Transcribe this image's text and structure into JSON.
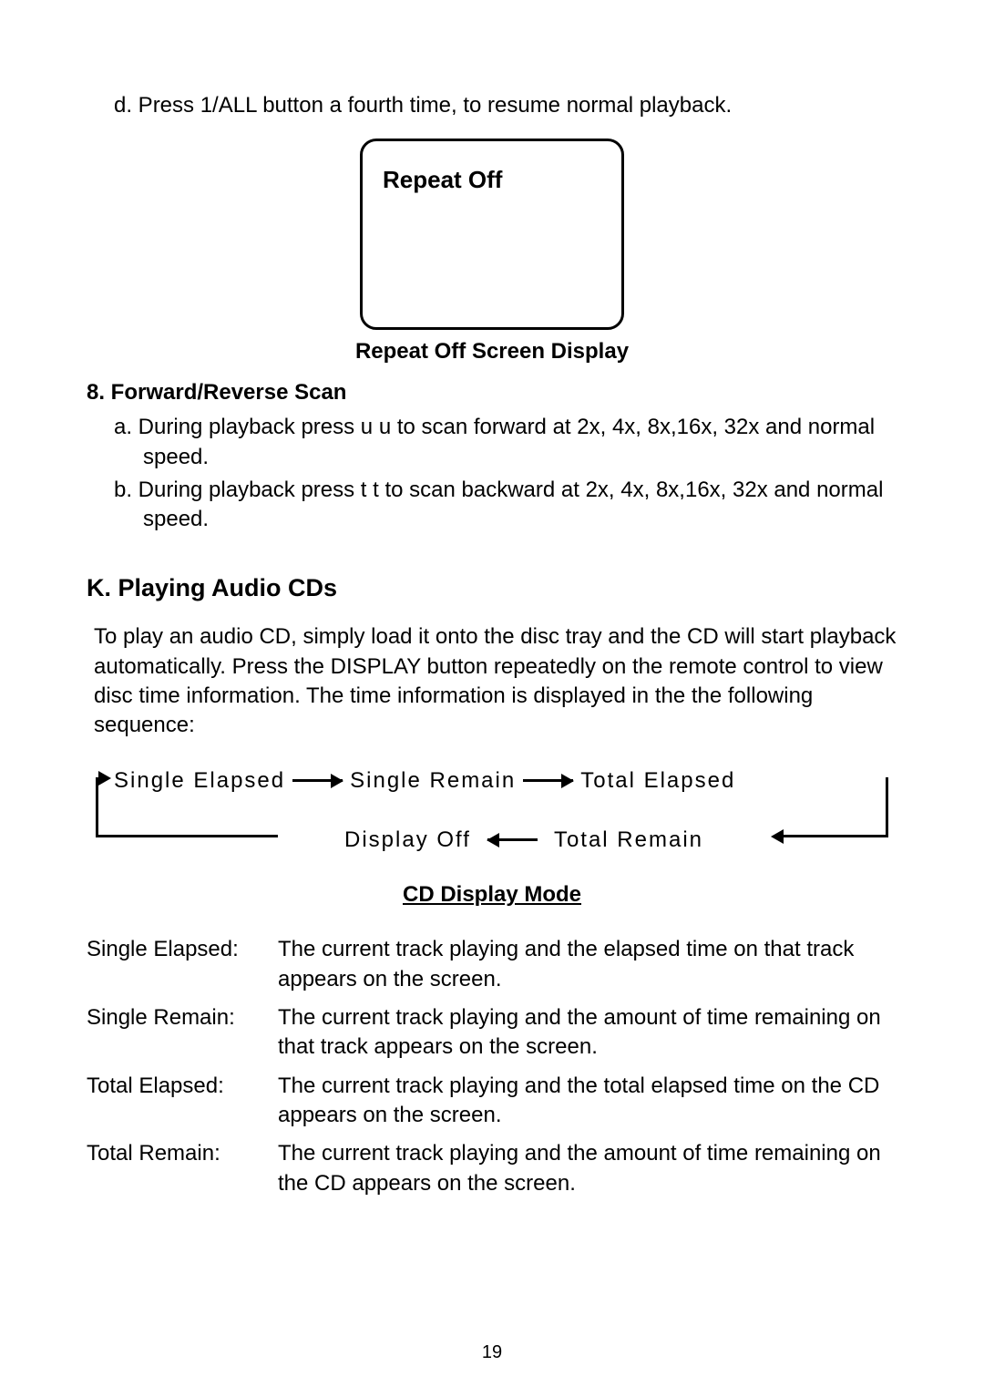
{
  "step_d": "d.  Press 1/ALL button a fourth time, to resume normal playback.",
  "screen_box": "Repeat  Off",
  "repeat_caption": "Repeat Off Screen Display",
  "section8_title": "8. Forward/Reverse Scan",
  "section8_a": "a. During playback press u u   to scan forward at 2x, 4x, 8x,16x, 32x and normal speed.",
  "section8_b": "b. During playback press t  t    to scan backward at 2x, 4x, 8x,16x, 32x and normal speed.",
  "section_k_title": "K. Playing Audio CDs",
  "section_k_para": "To play an audio CD, simply load it onto the disc tray and the CD will start playback automatically. Press the DISPLAY button repeatedly on the remote control to view disc time information. The time information is displayed in the the following sequence:",
  "diagram": {
    "single_elapsed": "Single Elapsed",
    "single_remain": "Single Remain",
    "total_elapsed": "Total Elapsed",
    "display_off": "Display Off",
    "total_remain": "Total  Remain"
  },
  "cd_display_mode": "CD Display Mode",
  "definitions": [
    {
      "term": "Single Elapsed:",
      "desc": "The current  track playing and the elapsed time on that track appears on the screen."
    },
    {
      "term": "Single Remain:",
      "desc": "The current track playing and the amount of time remaining on that track appears on the screen."
    },
    {
      "term": "Total Elapsed:",
      "desc": "The current  track playing and the total elapsed time on the CD appears on the screen."
    },
    {
      "term": "Total Remain:",
      "desc": "The current track playing and  the amount of time remaining on the CD appears on the screen."
    }
  ],
  "page_number": "19"
}
